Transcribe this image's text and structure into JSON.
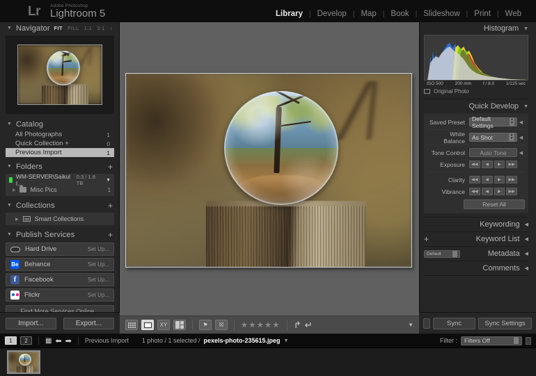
{
  "app": {
    "logo_mark": "Lr",
    "brand_line1": "Adobe Photoshop",
    "brand_line2": "Lightroom 5"
  },
  "modules": [
    {
      "label": "Library",
      "active": true
    },
    {
      "label": "Develop",
      "active": false
    },
    {
      "label": "Map",
      "active": false
    },
    {
      "label": "Book",
      "active": false
    },
    {
      "label": "Slideshow",
      "active": false
    },
    {
      "label": "Print",
      "active": false
    },
    {
      "label": "Web",
      "active": false
    }
  ],
  "left_panel": {
    "navigator": {
      "title": "Navigator",
      "zoom_levels": [
        {
          "label": "FIT",
          "active": true
        },
        {
          "label": "FILL",
          "active": false
        },
        {
          "label": "1:1",
          "active": false
        },
        {
          "label": "3:1",
          "active": false
        }
      ]
    },
    "catalog": {
      "title": "Catalog",
      "items": [
        {
          "label": "All Photographs",
          "count": "1",
          "selected": false
        },
        {
          "label": "Quick Collection  +",
          "count": "0",
          "selected": false
        },
        {
          "label": "Previous Import",
          "count": "1",
          "selected": true
        }
      ]
    },
    "folders": {
      "title": "Folders",
      "add_label": "+",
      "volume": {
        "name": "WM-SERVER\\Saikul I...",
        "size": "0.3 / 1.8 TB"
      },
      "children": [
        {
          "label": "Misc Pics",
          "count": "1"
        }
      ]
    },
    "collections": {
      "title": "Collections",
      "add_label": "+",
      "items": [
        {
          "label": "Smart Collections"
        }
      ]
    },
    "publish_services": {
      "title": "Publish Services",
      "add_label": "+",
      "items": [
        {
          "label": "Hard Drive",
          "action": "Set Up...",
          "icon": "hard-drive-icon"
        },
        {
          "label": "Behance",
          "action": "Set Up...",
          "icon": "behance-icon",
          "mark": "Be"
        },
        {
          "label": "Facebook",
          "action": "Set Up...",
          "icon": "facebook-icon",
          "mark": "f"
        },
        {
          "label": "Flickr",
          "action": "Set Up...",
          "icon": "flickr-icon"
        }
      ],
      "find_more": "Find More Services Online..."
    },
    "import_label": "Import...",
    "export_label": "Export..."
  },
  "right_panel": {
    "histogram": {
      "title": "Histogram",
      "iso": "ISO 500",
      "focal": "200 mm",
      "aperture": "f / 8.0",
      "shutter": "1/125 sec",
      "original_photo": "Original Photo"
    },
    "quick_develop": {
      "title": "Quick Develop",
      "saved_preset_label": "Saved Preset",
      "saved_preset_value": "Default Settings",
      "white_balance_label": "White Balance",
      "white_balance_value": "As Shot",
      "tone_control_label": "Tone Control",
      "auto_tone_label": "Auto Tone",
      "exposure_label": "Exposure",
      "clarity_label": "Clarity",
      "vibrance_label": "Vibrance",
      "reset_all_label": "Reset All"
    },
    "keywording_title": "Keywording",
    "keyword_list_title": "Keyword List",
    "keyword_list_add": "+",
    "metadata_title": "Metadata",
    "metadata_preset": "Default",
    "comments_title": "Comments",
    "sync_label": "Sync",
    "sync_settings_label": "Sync Settings"
  },
  "toolbar": {
    "view_modes": [
      {
        "name": "grid-view",
        "active": false
      },
      {
        "name": "loupe-view",
        "active": true
      },
      {
        "name": "compare-view",
        "active": false,
        "glyph": "XY"
      },
      {
        "name": "survey-view",
        "active": false
      }
    ],
    "flag_label": "⚑",
    "reject_label": "☒",
    "stars": "★★★★★",
    "rotate_left": "↵",
    "rotate_right": "↵"
  },
  "status_bar": {
    "pages": [
      {
        "label": "1",
        "active": true
      },
      {
        "label": "2",
        "active": false
      }
    ],
    "source_label": "Previous Import",
    "selection_text": "1 photo / 1 selected /",
    "filename": "pexels-photo-235615.jpeg",
    "filter_label": "Filter :",
    "filter_value": "Filters Off"
  },
  "colors": {
    "panel_bg": "#262626",
    "center_bg": "#606060",
    "accent_selected": "#b9b9b9",
    "topbar_bg": "#0e0e0e",
    "histogram_red": "#e01e1e",
    "histogram_yellow": "#f2e01e",
    "histogram_blue": "#2d6fd8",
    "histogram_green": "#1fbf3a"
  }
}
